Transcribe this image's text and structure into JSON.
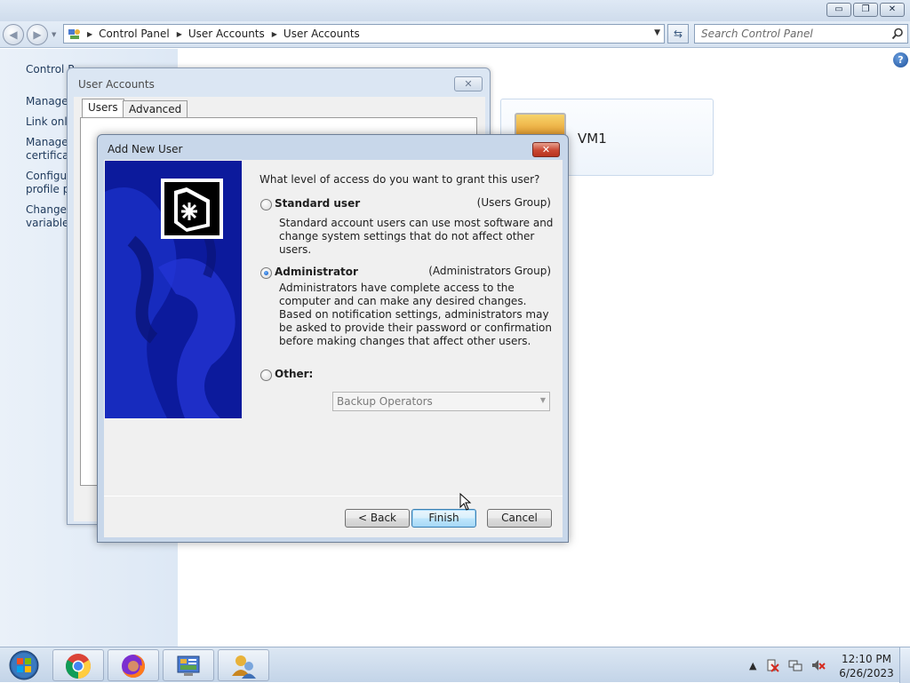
{
  "window": {
    "minimize_symbol": "▭",
    "restore_symbol": "❐",
    "close_symbol": "✕"
  },
  "nav": {
    "back_icon": "arrow-left-icon",
    "forward_icon": "arrow-right-icon",
    "breadcrumbs": [
      "Control Panel",
      "User Accounts",
      "User Accounts"
    ],
    "search_placeholder": "Search Control Panel"
  },
  "left_pane": {
    "items": [
      "Control P",
      "Manage",
      "Link onli",
      "Manage",
      "certificat",
      "Configu",
      "profile pr",
      "Change r",
      "variables"
    ]
  },
  "user_card": {
    "name": "VM1"
  },
  "user_accounts_dialog": {
    "title": "User Accounts",
    "close_symbol": "✕",
    "tabs": [
      {
        "label": "Users",
        "active": true
      },
      {
        "label": "Advanced",
        "active": false
      }
    ],
    "fragment": "U"
  },
  "wizard": {
    "title": "Add New User",
    "close_symbol": "✕",
    "question": "What level of access do you want to grant this user?",
    "options": [
      {
        "label": "Standard user",
        "group": "(Users Group)",
        "description": "Standard account users can use most software and change system settings that do not affect other users.",
        "checked": false
      },
      {
        "label": "Administrator",
        "group": "(Administrators Group)",
        "description": "Administrators have complete access to the computer and can make any desired changes. Based on notification settings, administrators may be asked to provide their password or confirmation before making changes that affect other users.",
        "checked": true
      },
      {
        "label": "Other:",
        "checked": false
      }
    ],
    "other_select": {
      "value": "Backup Operators",
      "disabled": true
    },
    "buttons": {
      "back": "< Back",
      "finish": "Finish",
      "cancel": "Cancel"
    }
  },
  "taskbar": {
    "apps": [
      "chrome-icon",
      "firefox-icon",
      "control-panel-icon",
      "user-accounts-icon"
    ],
    "tray": {
      "show_hidden": "▲"
    },
    "clock": {
      "time": "12:10 PM",
      "date": "6/26/2023"
    }
  },
  "colors": {
    "wizard_art": "#0c1a9c",
    "close_red": "#c94732",
    "taskbar": "#c3d4e8"
  }
}
